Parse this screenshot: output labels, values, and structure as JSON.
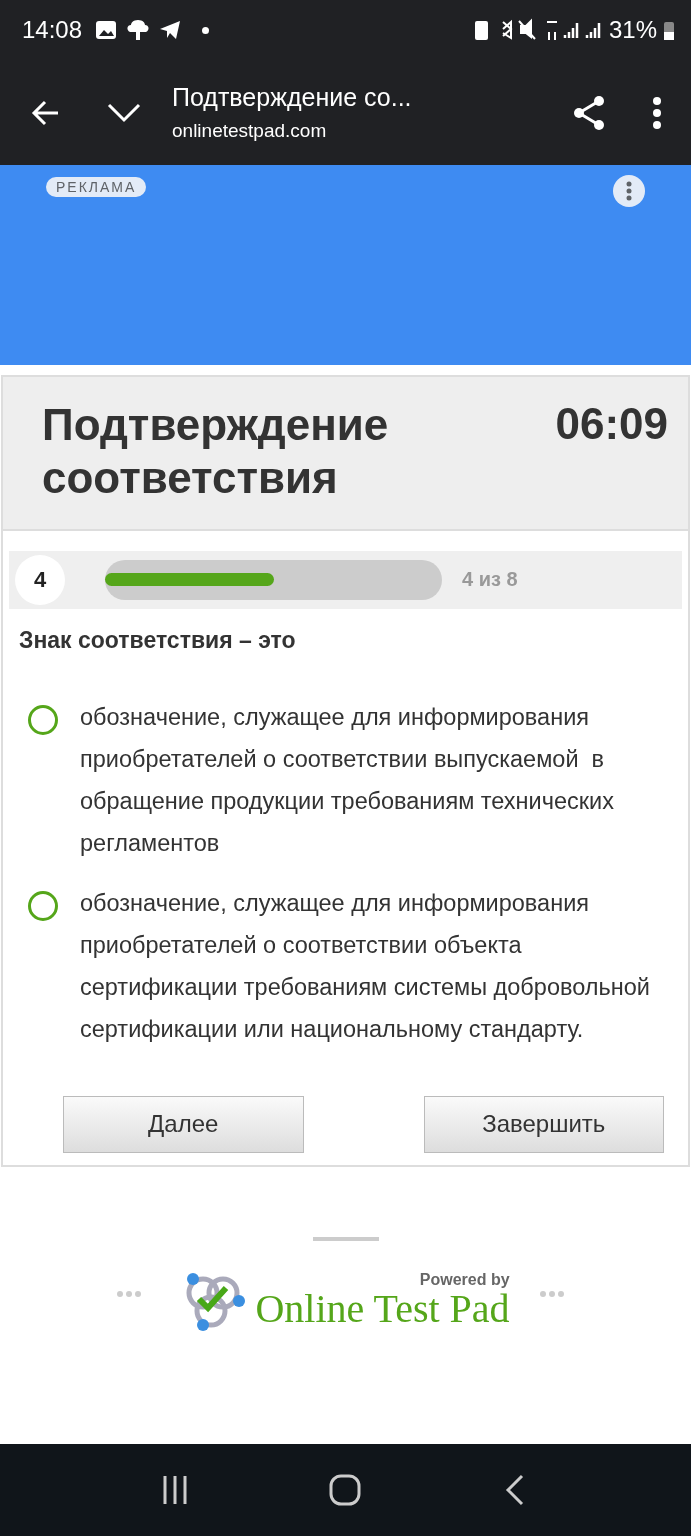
{
  "status_bar": {
    "time": "14:08",
    "battery": "31%"
  },
  "browser_bar": {
    "title": "Подтверждение со...",
    "url": "onlinetestpad.com"
  },
  "ad": {
    "label": "РЕКЛАМА"
  },
  "test": {
    "title": "Подтверждение соответствия",
    "timer": "06:09"
  },
  "progress": {
    "number": "4",
    "level": 0.5,
    "counter": "4 из 8"
  },
  "question": "Знак соответствия – это",
  "options": [
    {
      "text": "обозначение, служащее для информирования  приобретателей о соответствии выпускаемой  в обращение продукции требованиям технических регламентов",
      "selected": false
    },
    {
      "text": "обозначение, служащее для информирования приобретателей о соответствии объекта сертификации требованиям системы добровольной сертификации или национальному стандарту.",
      "selected": false
    }
  ],
  "buttons": [
    "Далее",
    "Завершить"
  ],
  "footer": {
    "powered": "Powered by",
    "brand": "Online Test Pad"
  }
}
